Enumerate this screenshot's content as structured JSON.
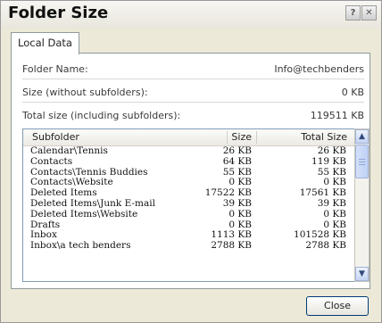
{
  "window": {
    "title": "Folder Size"
  },
  "tabs": [
    {
      "label": "Local Data"
    }
  ],
  "info": {
    "folder_name_label": "Folder Name:",
    "folder_name_value": "Info@techbenders",
    "size_label": "Size (without subfolders):",
    "size_value": "0 KB",
    "total_label": "Total size (including subfolders):",
    "total_value": "119511 KB"
  },
  "table": {
    "headers": {
      "subfolder": "Subfolder",
      "size": "Size",
      "total": "Total Size"
    },
    "rows": [
      {
        "name": "Calendar\\Tennis",
        "size": "26 KB",
        "total": "26 KB"
      },
      {
        "name": "Contacts",
        "size": "64 KB",
        "total": "119 KB"
      },
      {
        "name": "Contacts\\Tennis Buddies",
        "size": "55 KB",
        "total": "55 KB"
      },
      {
        "name": "Contacts\\Website",
        "size": "0 KB",
        "total": "0 KB"
      },
      {
        "name": "Deleted Items",
        "size": "17522 KB",
        "total": "17561 KB"
      },
      {
        "name": "Deleted Items\\Junk E-mail",
        "size": "39 KB",
        "total": "39 KB"
      },
      {
        "name": "Deleted Items\\Website",
        "size": "0 KB",
        "total": "0 KB"
      },
      {
        "name": "Drafts",
        "size": "0 KB",
        "total": "0 KB"
      },
      {
        "name": "Inbox",
        "size": "1113 KB",
        "total": "101528 KB"
      },
      {
        "name": "Inbox\\a tech benders",
        "size": "2788 KB",
        "total": "2788 KB"
      }
    ]
  },
  "buttons": {
    "close": "Close"
  },
  "icons": {
    "help": "help-icon",
    "window_close": "close-icon",
    "scroll_up": "chevron-up-icon",
    "scroll_down": "chevron-down-icon"
  }
}
